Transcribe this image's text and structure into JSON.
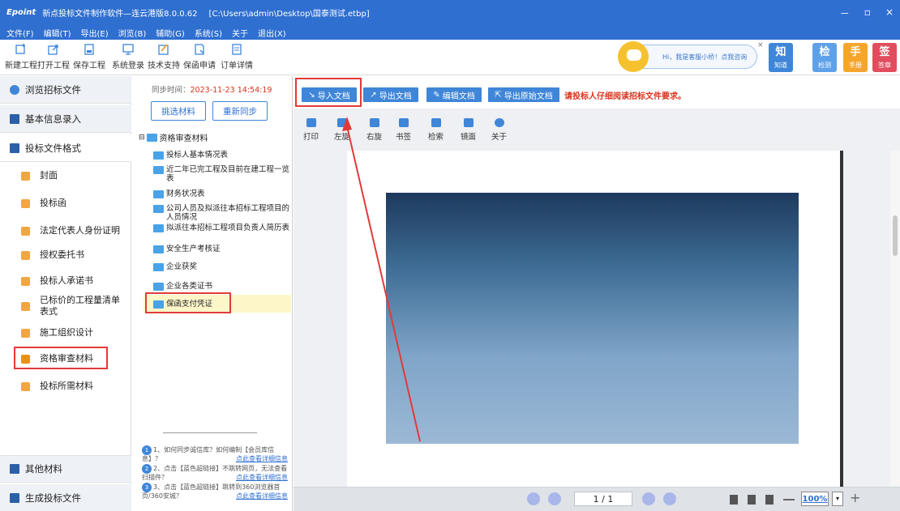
{
  "window": {
    "logo": "Epoint",
    "title": "新点投标文件制作软件—连云港版8.0.0.62",
    "path": "[C:\\Users\\admin\\Desktop\\国泰测试.etbp]",
    "controls": [
      "－",
      "▫",
      "×"
    ]
  },
  "menu": [
    "文件(F)",
    "编辑(T)",
    "导出(E)",
    "浏览(B)",
    "辅助(G)",
    "系统(S)",
    "关于",
    "退出(X)"
  ],
  "toolbar": {
    "new": "新建工程",
    "open": "打开工程",
    "save": "保存工程",
    "login": "系统登录",
    "support": "技术支持",
    "guarantee": "保函申请",
    "order": "订单详情"
  },
  "assistant": {
    "text": "Hi，我是客服小桥！点我咨询",
    "close": "×"
  },
  "quick": [
    {
      "glyph": "知",
      "label": "知道",
      "color": "#3f86d8"
    },
    {
      "glyph": "检",
      "label": "检测",
      "color": "#5fa1e8"
    },
    {
      "glyph": "手",
      "label": "手册",
      "color": "#f5a62a"
    },
    {
      "glyph": "签",
      "label": "签章",
      "color": "#e24d5e"
    }
  ],
  "nav": {
    "browse": "浏览招标文件",
    "basic": "基本信息录入",
    "format": "投标文件格式",
    "items": [
      "封面",
      "投标函",
      "法定代表人身份证明",
      "授权委托书",
      "投标人承诺书",
      "已标价的工程量清单表式",
      "施工组织设计",
      "资格审查材料",
      "投标所需材料"
    ],
    "other": "其他材料",
    "generate": "生成投标文件"
  },
  "mid": {
    "sync_label": "同步时间：",
    "sync_time": "2023-11-23 14:54:19",
    "pick_btn": "挑选材料",
    "resync_btn": "重新同步",
    "tree_root": "资格审查材料",
    "tree_items": [
      "投标人基本情况表",
      "近二年已完工程及目前在建工程一览表",
      "财务状况表",
      "公司人员及拟派往本招标工程项目的人员情况",
      "拟派往本招标工程项目负责人简历表",
      "安全生产考核证",
      "企业获奖",
      "企业各类证书",
      "保函支付凭证"
    ],
    "hints": [
      {
        "num": "1",
        "text": "1、如何同步诚信库？如何编制【会员库信息】？",
        "link": "点此查看详细信息"
      },
      {
        "num": "2",
        "text": "2、点击【蓝色超链接】不跳转网页，无法查看扫描件？",
        "link": "点此查看详细信息"
      },
      {
        "num": "3",
        "text": "3、点击【蓝色超链接】跳转到360浏览器首页/360安城？",
        "link": "点此查看详细信息"
      }
    ]
  },
  "viewer": {
    "import": "导入文档",
    "export": "导出文档",
    "edit": "编辑文档",
    "export_orig": "导出原始文档",
    "warning": "请投标人仔细阅读招标文件要求。",
    "tools": [
      "打印",
      "左旋",
      "右旋",
      "书签",
      "检索",
      "镜面",
      "关于"
    ],
    "page": "1 / 1",
    "zoom": "100%"
  }
}
